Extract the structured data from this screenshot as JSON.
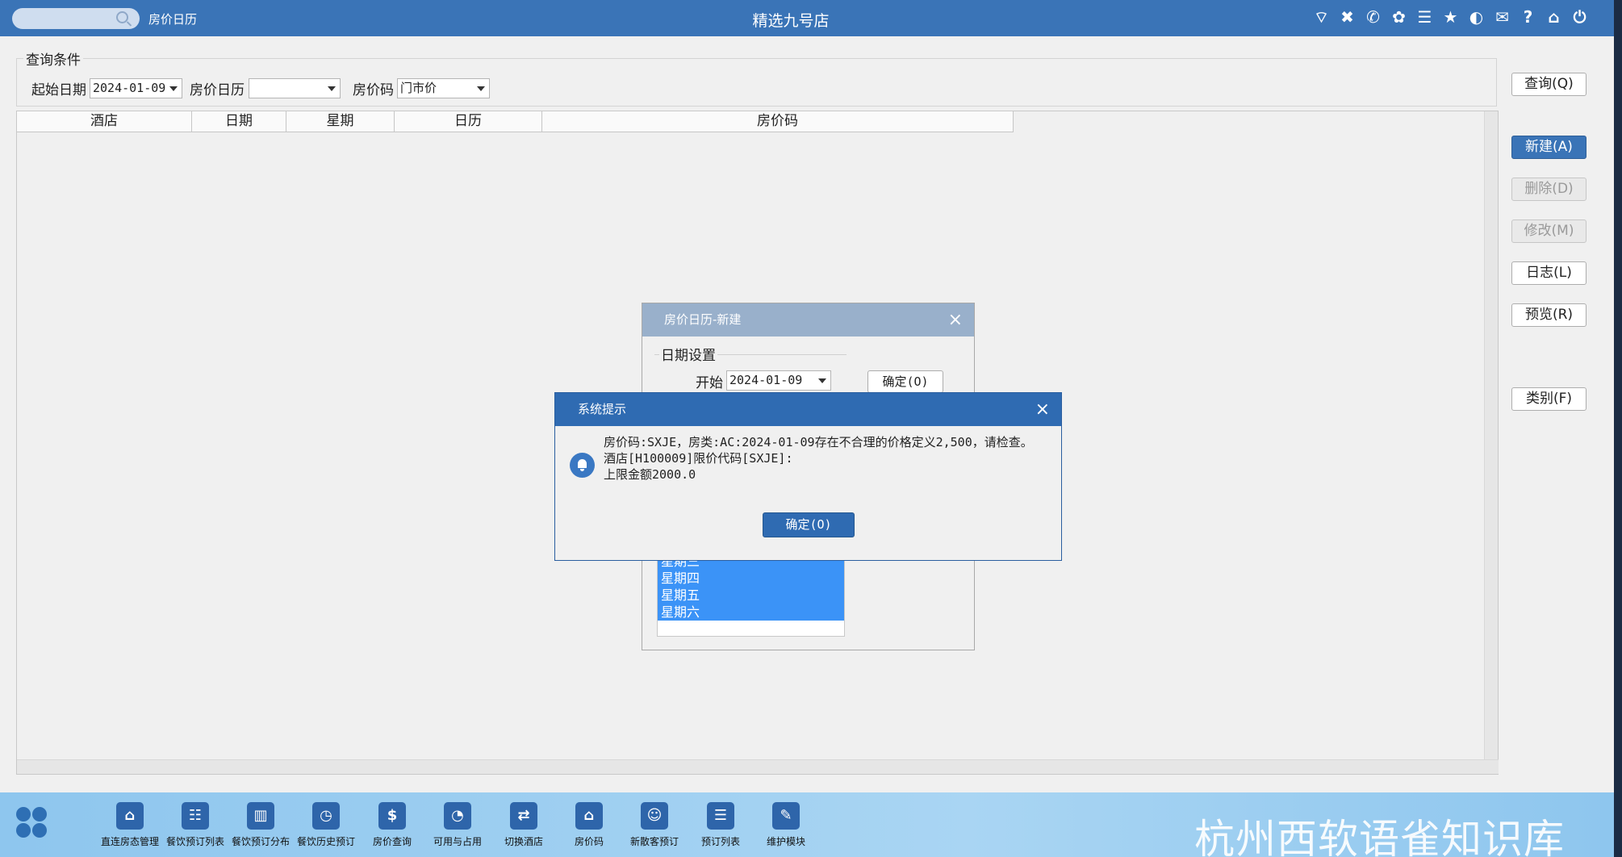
{
  "topbar": {
    "module": "房价日历",
    "title": "精选九号店",
    "icons": [
      "wifi-icon",
      "tools-icon",
      "phone-icon",
      "palette-icon",
      "menu-icon",
      "star-icon",
      "moon-icon",
      "mail-icon",
      "help-icon",
      "home-icon",
      "power-icon"
    ]
  },
  "query": {
    "legend": "查询条件",
    "start_label": "起始日期",
    "start_value": "2024-01-09",
    "calendar_label": "房价日历",
    "calendar_value": "",
    "code_label": "房价码",
    "code_value": "门市价"
  },
  "grid": {
    "columns": [
      "酒店",
      "日期",
      "星期",
      "日历",
      "房价码"
    ]
  },
  "buttons": {
    "query": "查询(Q)",
    "new": "新建(A)",
    "delete": "删除(D)",
    "modify": "修改(M)",
    "log": "日志(L)",
    "preview": "预览(R)",
    "category": "类别(F)"
  },
  "new_dialog": {
    "title": "房价日历-新建",
    "date_legend": "日期设置",
    "start_label": "开始",
    "start_value": "2024-01-09",
    "ok": "确定(O)",
    "weekdays": [
      "星期三",
      "星期四",
      "星期五",
      "星期六"
    ]
  },
  "alert": {
    "title": "系统提示",
    "line1": "房价码:SXJE，房类:AC:2024-01-09存在不合理的价格定义2,500，请检查。",
    "line2": "酒店[H100009]限价代码[SXJE]:",
    "line3": "上限金额2000.0",
    "ok": "确定(O)"
  },
  "taskbar": {
    "items": [
      {
        "label": "直连房态管理",
        "icon": "house-icon"
      },
      {
        "label": "餐饮预订列表",
        "icon": "clipboard-icon"
      },
      {
        "label": "餐饮预订分布",
        "icon": "building-icon"
      },
      {
        "label": "餐饮历史预订",
        "icon": "clock-icon"
      },
      {
        "label": "房价查询",
        "icon": "coins-icon"
      },
      {
        "label": "可用与占用",
        "icon": "pie-chart-icon"
      },
      {
        "label": "切换酒店",
        "icon": "switch-icon"
      },
      {
        "label": "房价码",
        "icon": "house-icon"
      },
      {
        "label": "新散客预订",
        "icon": "user-add-icon"
      },
      {
        "label": "预订列表",
        "icon": "document-icon"
      },
      {
        "label": "维护模块",
        "icon": "wrench-icon"
      }
    ]
  },
  "watermark": "杭州西软语雀知识库"
}
